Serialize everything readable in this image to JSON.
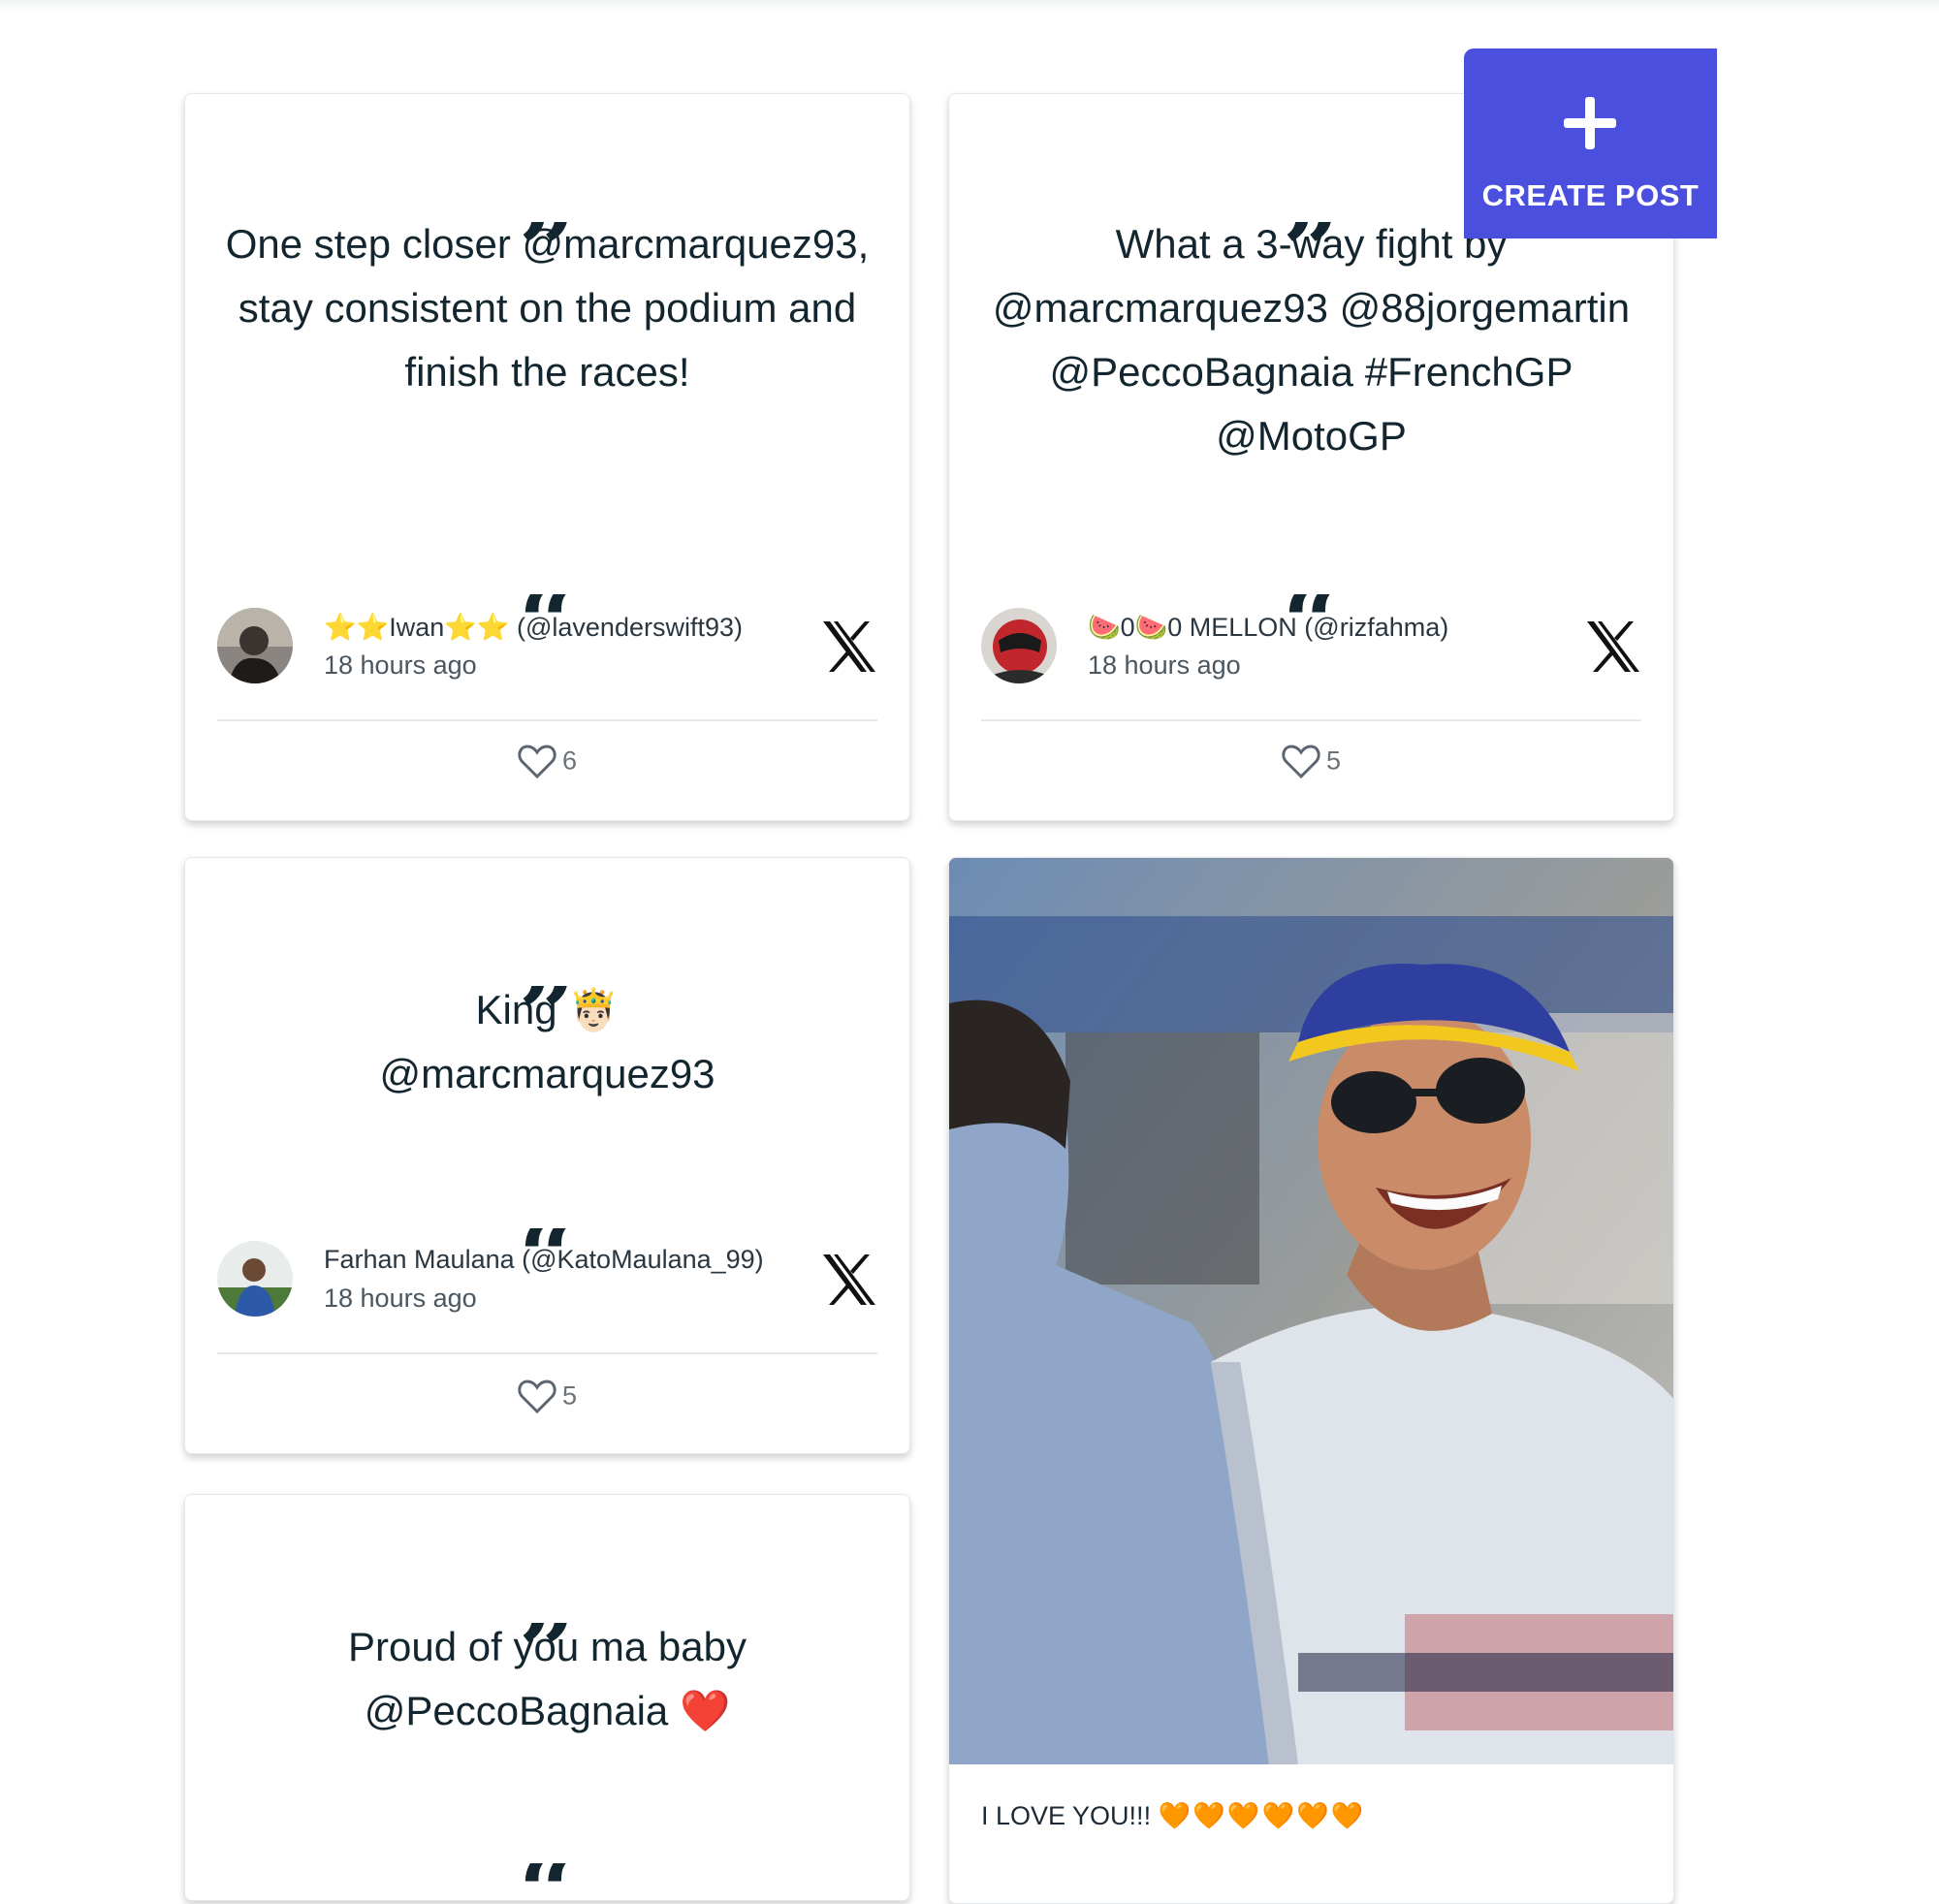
{
  "create_post": {
    "label": "CREATE POST",
    "icon": "plus-icon",
    "color": "#4a4fde"
  },
  "posts": [
    {
      "text": "One step closer @marcmarquez93, stay consistent on the podium and finish the races!",
      "author_name": "⭐⭐Iwan⭐⭐ (@lavenderswift93)",
      "time": "18 hours ago",
      "likes": "6",
      "source_icon": "x-logo-icon"
    },
    {
      "text": "What a 3-way fight by @marcmarquez93 @88jorgemartin @PeccoBagnaia #FrenchGP @MotoGP",
      "author_name": "🍉0🍉0 MELLON (@rizfahma)",
      "time": "18 hours ago",
      "likes": "5",
      "source_icon": "x-logo-icon"
    },
    {
      "text": "King 🤴🏻 @marcmarquez93",
      "author_name": "Farhan Maulana (@KatoMaulana_99)",
      "time": "18 hours ago",
      "likes": "5",
      "source_icon": "x-logo-icon"
    },
    {
      "text": "Proud of you ma baby @PeccoBagnaia ❤️"
    }
  ],
  "photo_post": {
    "caption": "I LOVE YOU!!!",
    "caption_emoji": "🧡🧡🧡🧡🧡🧡"
  },
  "quote_open": "”",
  "quote_close": "“"
}
